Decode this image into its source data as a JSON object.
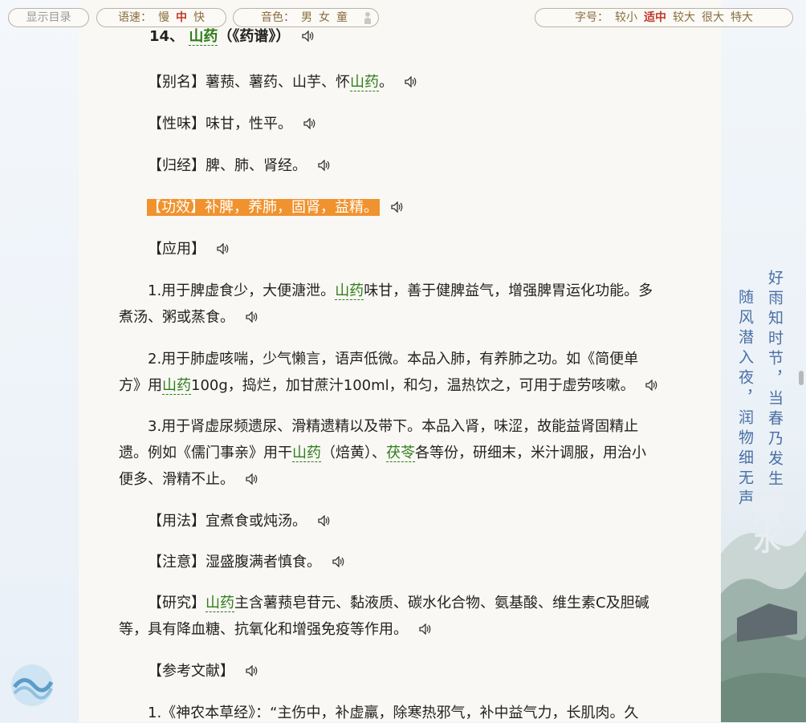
{
  "toolbar": {
    "toc_label": "显示目录",
    "speed_label": "语速：",
    "speed_options": [
      "慢",
      "中",
      "快"
    ],
    "speed_active": "中",
    "voice_label": "音色：",
    "voice_options": [
      "男",
      "女",
      "童"
    ],
    "font_label": "字号：",
    "font_options": [
      "较小",
      "适中",
      "较大",
      "很大",
      "特大"
    ],
    "font_active": "适中"
  },
  "entry": {
    "number": "14、",
    "herb": "山药",
    "title_suffix": "（《药谱》）",
    "alias_label": "【别名】",
    "alias_text": "薯蓣、薯药、山芋、怀",
    "alias_herb": "山药",
    "alias_end": "。",
    "nature_label": "【性味】",
    "nature_text": "味甘，性平。",
    "meridian_label": "【归经】",
    "meridian_text": "脾、肺、肾经。",
    "effect_label": "【功效】",
    "effect_text": "补脾，养肺，固肾，益精。",
    "usage_label": "【应用】",
    "app1_line1_a": "1.用于脾虚食少，大便溏泄。",
    "app1_herb": "山药",
    "app1_line1_b": "味甘，善于健脾益气，增强脾胃运化功能。多",
    "app1_line2": "煮汤、粥或蒸食。",
    "app2_line1": "2.用于肺虚咳喘，少气懒言，语声低微。本品入肺，有养肺之功。如《简便单",
    "app2_line2_a": "方》用",
    "app2_herb": "山药",
    "app2_line2_b": "100g，捣烂，加甘蔗汁100ml，和匀，温热饮之，可用于虚劳咳嗽。",
    "app3_line1": "3.用于肾虚尿频遗尿、滑精遗精以及带下。本品入肾，味涩，故能益肾固精止",
    "app3_line2_a": "遗。例如《儒门事亲》用干",
    "app3_herb": "山药",
    "app3_line2_b": "（焙黄）、",
    "app3_herb2": "茯苓",
    "app3_line2_c": "各等份，研细末，米汁调服，用治小",
    "app3_line3": "便多、滑精不止。",
    "method_label": "【用法】",
    "method_text": "宜煮食或炖汤。",
    "caution_label": "【注意】",
    "caution_text": "湿盛腹满者慎食。",
    "research_label": "【研究】",
    "research_herb": "山药",
    "research_line1": "主含薯蓣皂苷元、黏液质、碳水化合物、氨基酸、维生素C及胆碱",
    "research_line2": "等，具有降血糖、抗氧化和增强免疫等作用。",
    "ref_label": "【参考文献】",
    "ref1": "1.《神农本草经》：“主伤中，补虚羸，除寒热邪气，补中益气力，长肌肉。久"
  },
  "decoration": {
    "poem_col1": "好雨知时节，当春乃发生",
    "poem_col2": "随风潜入夜，润物细无声",
    "seal": "雨水"
  },
  "colors": {
    "herb": "#2e7d1a",
    "highlight": "#f29233",
    "active": "#c0392b",
    "toolbar_text": "#8a6d3f"
  }
}
